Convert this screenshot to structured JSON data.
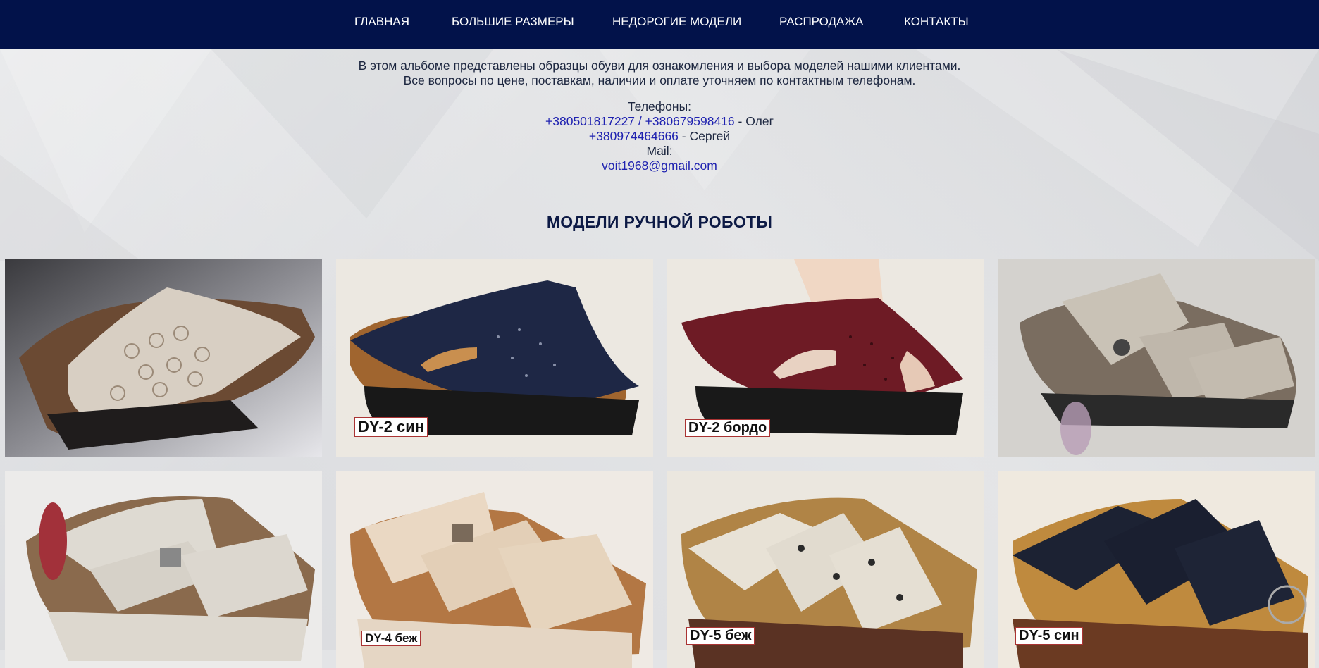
{
  "nav": {
    "items": [
      "ГЛАВНАЯ",
      "БОЛЬШИЕ РАЗМЕРЫ",
      "НЕДОРОГИЕ МОДЕЛИ",
      "РАСПРОДАЖА",
      "КОНТАКТЫ"
    ]
  },
  "intro": {
    "line1": "В этом альбоме представлены образцы обуви для ознакомления и выбора моделей нашими клиентами.",
    "line2": "Все вопросы по цене, поставкам, наличии и оплате уточняем по контактным телефонам."
  },
  "contacts": {
    "phones_label": "Телефоны:",
    "phone1": "+380501817227",
    "separator": " / ",
    "phone2": "+380679598416",
    "name1": " - Олег",
    "phone3": "+380974464666",
    "name2": " - Сергей",
    "mail_label": "Mail:",
    "email": "voit1968@gmail.com"
  },
  "section": {
    "title": "МОДЕЛИ РУЧНОЙ РОБОТЫ"
  },
  "products": [
    {
      "label": ""
    },
    {
      "label": "DY-2 син"
    },
    {
      "label": "DY-2 бордо"
    },
    {
      "label": ""
    },
    {
      "label": ""
    },
    {
      "label": "DY-4 беж"
    },
    {
      "label": "DY-5 беж"
    },
    {
      "label": "DY-5 син"
    }
  ],
  "colors": {
    "navbar": "#02124a",
    "link": "#1f22b0",
    "title": "#0d1a45"
  }
}
